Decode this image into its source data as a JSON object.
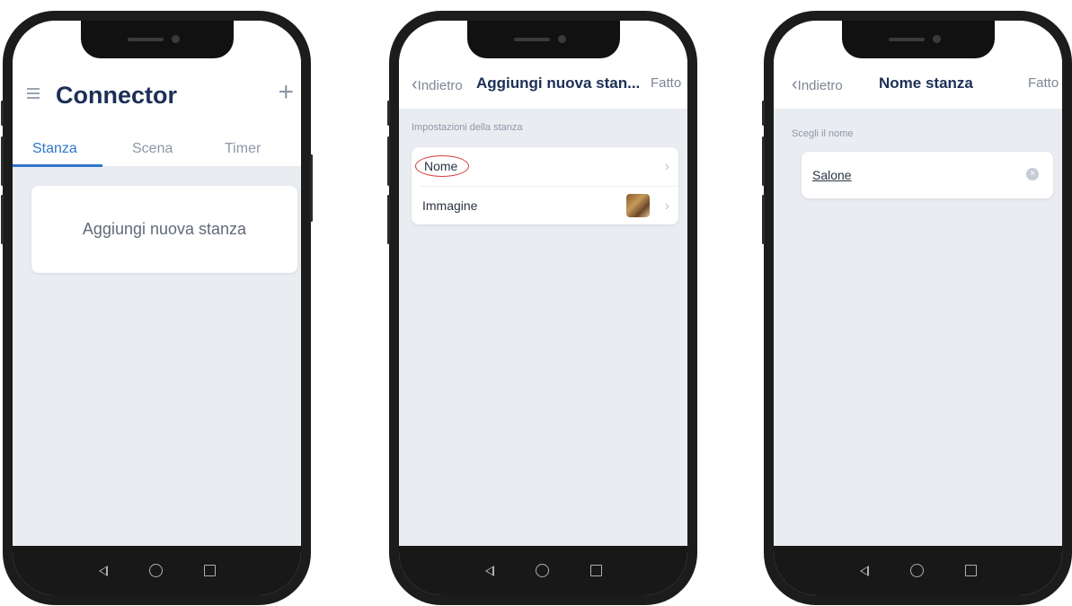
{
  "screen1": {
    "app_title": "Connector",
    "menu_icon": "hamburger-icon",
    "add_icon": "plus-icon",
    "tabs": [
      {
        "label": "Stanza",
        "active": true
      },
      {
        "label": "Scena",
        "active": false
      },
      {
        "label": "Timer",
        "active": false
      }
    ],
    "add_room_label": "Aggiungi nuova stanza"
  },
  "screen2": {
    "back_label": "Indietro",
    "title": "Aggiungi nuova stan...",
    "done_label": "Fatto",
    "section_label": "Impostazioni della stanza",
    "rows": [
      {
        "label": "Nome"
      },
      {
        "label": "Immagine"
      }
    ]
  },
  "screen3": {
    "back_label": "Indietro",
    "title": "Nome stanza",
    "done_label": "Fatto",
    "section_label": "Scegli il nome",
    "name_value": "Salone"
  },
  "colors": {
    "accent": "#2f76c9",
    "title": "#1d2f57",
    "screen_bg": "#e9ecf1",
    "highlight_circle": "#d43d3d"
  },
  "navbar_icons": [
    "back-triangle-icon",
    "home-circle-icon",
    "recents-square-icon"
  ]
}
